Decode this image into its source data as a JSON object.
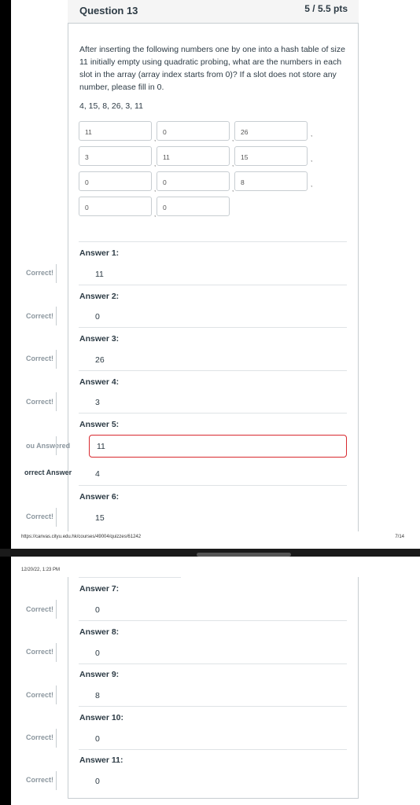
{
  "question": {
    "title": "Question 13",
    "points": "5 / 5.5 pts",
    "text": "After inserting the following numbers one by one into a hash table of size 11 initially empty using quadratic probing, what are the numbers in each slot in the array (array index starts from 0)? If a slot does not store any number, please fill in 0.",
    "sequence": "4, 15, 8, 26, 3, 11"
  },
  "inputs": [
    "11",
    "0",
    "26",
    "3",
    "11",
    "15",
    "0",
    "0",
    "8",
    "0",
    "0"
  ],
  "comma": ",",
  "answers": [
    {
      "label": "Answer 1:",
      "value": "11",
      "status": "Correct!"
    },
    {
      "label": "Answer 2:",
      "value": "0",
      "status": "Correct!"
    },
    {
      "label": "Answer 3:",
      "value": "26",
      "status": "Correct!"
    },
    {
      "label": "Answer 4:",
      "value": "3",
      "status": "Correct!"
    },
    {
      "label": "Answer 5:",
      "value": "11",
      "status": "ou Answered",
      "correct_status": "orrect Answer",
      "correct_value": "4"
    },
    {
      "label": "Answer 6:",
      "value": "15",
      "status": "Correct!"
    },
    {
      "label": "Answer 7:",
      "value": "0",
      "status": "Correct!"
    },
    {
      "label": "Answer 8:",
      "value": "0",
      "status": "Correct!"
    },
    {
      "label": "Answer 9:",
      "value": "8",
      "status": "Correct!"
    },
    {
      "label": "Answer 10:",
      "value": "0",
      "status": "Correct!"
    },
    {
      "label": "Answer 11:",
      "value": "0",
      "status": "Correct!"
    }
  ],
  "footer": {
    "url": "https://canvas.cityu.edu.hk/courses/49004/quizzes/61242",
    "page": "7/14"
  },
  "page2_header": {
    "date": "12/20/22, 1:23 PM"
  },
  "colors": {
    "text": "#2d3b45",
    "border": "#c7cdd1",
    "wrong_border": "#d8292f",
    "status_gray": "#8b969e"
  }
}
